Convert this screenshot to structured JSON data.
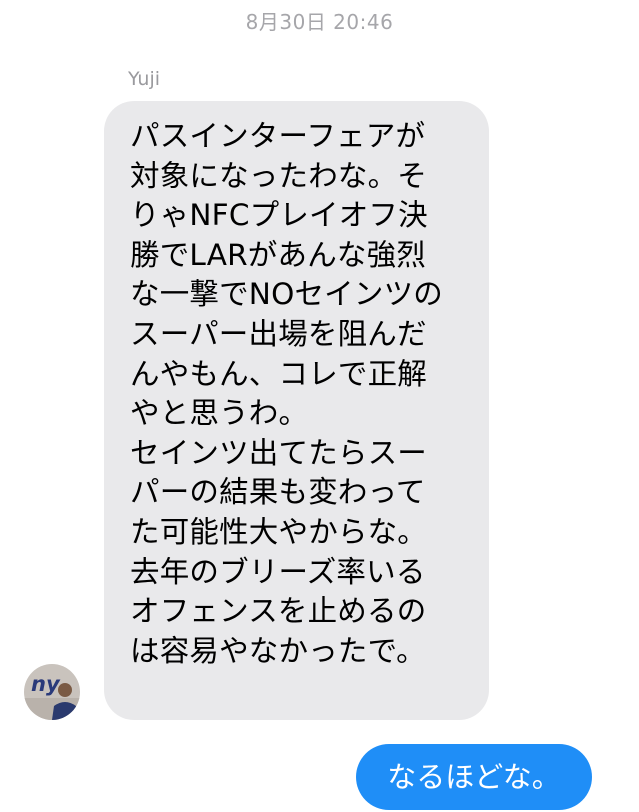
{
  "conversation": {
    "timestamp": "8月30日 20:46"
  },
  "incoming_message": {
    "sender_name": "Yuji",
    "lines": [
      "パスインターフェアが",
      "対象になったわな。そ",
      "りゃNFCプレイオフ決",
      "勝でLARがあんな強烈",
      "な一撃でNOセインツの",
      "スーパー出場を阻んだ",
      "んやもん、コレで正解",
      "やと思うわ。",
      "セインツ出てたらスー",
      "パーの結果も変わって",
      "た可能性大やからな。",
      "去年のブリーズ率いる",
      "オフェンスを止めるの",
      "は容易やなかったで。"
    ],
    "avatar": {
      "icon": "ny-giants-logo-avatar",
      "logo_text": "ny",
      "bg_color": "#c9c3bd",
      "logo_color": "#2a3a7a",
      "jersey_color": "#2a3a6e"
    }
  },
  "outgoing_message": {
    "text": "なるほどな。",
    "bubble_color": "#1f8ef7"
  }
}
